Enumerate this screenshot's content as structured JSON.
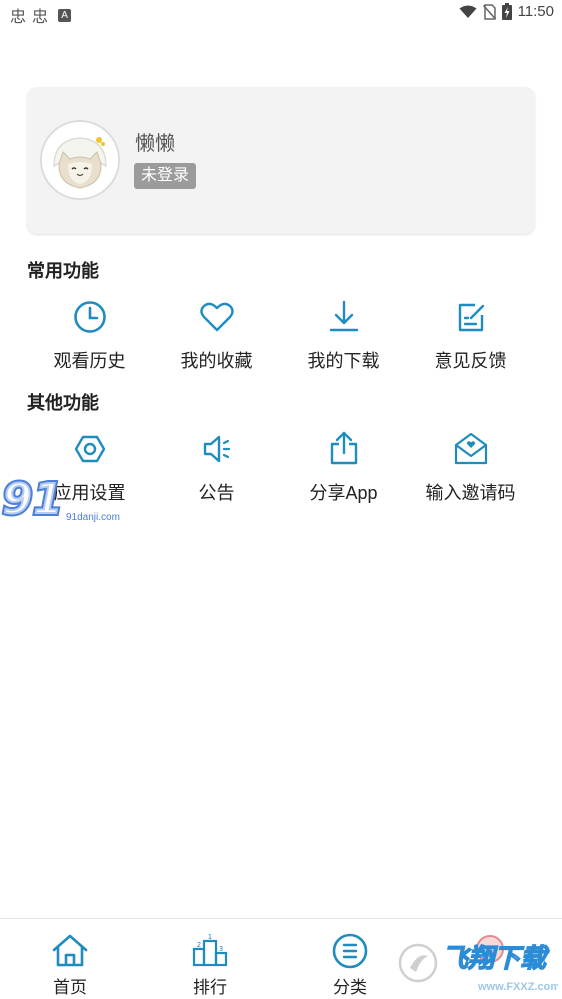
{
  "status_bar": {
    "left_glyphs": [
      "忠",
      "忠"
    ],
    "a_badge": "A",
    "time": "11:50",
    "icons": [
      "wifi-icon",
      "no-sim-icon",
      "battery-charging-icon"
    ]
  },
  "profile": {
    "name": "懒懒",
    "login_status": "未登录"
  },
  "common": {
    "title": "常用功能",
    "items": [
      {
        "label": "观看历史",
        "icon": "clock-icon"
      },
      {
        "label": "我的收藏",
        "icon": "heart-icon"
      },
      {
        "label": "我的下载",
        "icon": "download-icon"
      },
      {
        "label": "意见反馈",
        "icon": "edit-icon"
      }
    ]
  },
  "other": {
    "title": "其他功能",
    "items": [
      {
        "label": "应用设置",
        "icon": "settings-hexagon-icon"
      },
      {
        "label": "公告",
        "icon": "speaker-icon"
      },
      {
        "label": "分享App",
        "icon": "share-icon"
      },
      {
        "label": "输入邀请码",
        "icon": "envelope-heart-icon"
      }
    ]
  },
  "watermark_91": {
    "main": "91",
    "sub": "91danji.com"
  },
  "watermark_fxxz": {
    "main": "飞翔下载",
    "sub": "www.FXXZ.com"
  },
  "bottom_nav": {
    "items": [
      {
        "label": "首页",
        "icon": "home-icon"
      },
      {
        "label": "排行",
        "icon": "podium-icon"
      },
      {
        "label": "分类",
        "icon": "list-circle-icon"
      },
      {
        "label": "",
        "icon": "profile-icon"
      }
    ]
  },
  "colors": {
    "accent": "#1f8cc0",
    "card_bg": "#f3f3f3",
    "badge_bg": "#9b9b9b",
    "watermark_blue": "#4a7ed8"
  }
}
